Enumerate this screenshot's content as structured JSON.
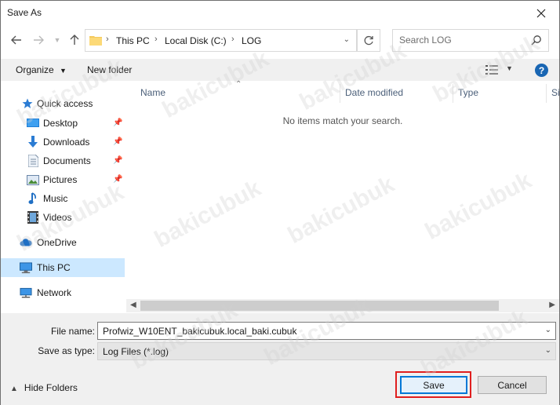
{
  "window": {
    "title": "Save As"
  },
  "nav": {
    "breadcrumb": [
      "This PC",
      "Local Disk (C:)",
      "LOG"
    ],
    "search_placeholder": "Search LOG"
  },
  "toolbar": {
    "organize": "Organize",
    "new_folder": "New folder"
  },
  "sidebar": {
    "items": [
      {
        "label": "Quick access",
        "icon": "star-icon"
      },
      {
        "label": "Desktop",
        "icon": "desktop-icon",
        "pinned": true
      },
      {
        "label": "Downloads",
        "icon": "download-icon",
        "pinned": true
      },
      {
        "label": "Documents",
        "icon": "document-icon",
        "pinned": true
      },
      {
        "label": "Pictures",
        "icon": "picture-icon",
        "pinned": true
      },
      {
        "label": "Music",
        "icon": "music-icon"
      },
      {
        "label": "Videos",
        "icon": "video-icon"
      },
      {
        "label": "OneDrive",
        "icon": "cloud-icon"
      },
      {
        "label": "This PC",
        "icon": "computer-icon",
        "selected": true
      },
      {
        "label": "Network",
        "icon": "network-icon"
      }
    ]
  },
  "list": {
    "columns": [
      "Name",
      "Date modified",
      "Type",
      "Si"
    ],
    "empty_message": "No items match your search."
  },
  "form": {
    "file_name_label": "File name:",
    "file_name_value": "Profwiz_W10ENT_bakicubuk.local_baki.cubuk",
    "save_as_type_label": "Save as type:",
    "save_as_type_value": "Log Files (*.log)"
  },
  "footer": {
    "hide_folders": "Hide Folders",
    "save": "Save",
    "cancel": "Cancel"
  },
  "watermark": "bakicubuk",
  "colors": {
    "selected_bg": "#cce8ff",
    "accent": "#0078d7",
    "highlight": "#e01f1f"
  }
}
